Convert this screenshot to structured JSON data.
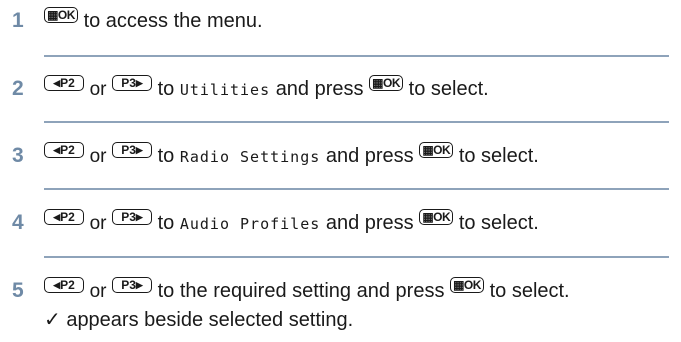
{
  "buttons": {
    "ok": "▦OK",
    "p2": "P2",
    "p3": "P3",
    "left_tri": "◀",
    "right_tri": "▶"
  },
  "steps": [
    {
      "number": "1",
      "pre": "",
      "mid": "to access the menu.",
      "post": ""
    },
    {
      "number": "2",
      "or": "or",
      "to": "to",
      "item": "Utilities",
      "press": "and press",
      "end": "to select."
    },
    {
      "number": "3",
      "or": "or",
      "to": "to",
      "item": "Radio Settings",
      "press": "and press",
      "end": "to select."
    },
    {
      "number": "4",
      "or": "or",
      "to": "to",
      "item": "Audio Profiles",
      "press": "and press",
      "end": "to select."
    },
    {
      "number": "5",
      "or": "or",
      "to": "to the required setting and press",
      "end": "to select."
    }
  ],
  "note": "✓ appears beside selected setting."
}
